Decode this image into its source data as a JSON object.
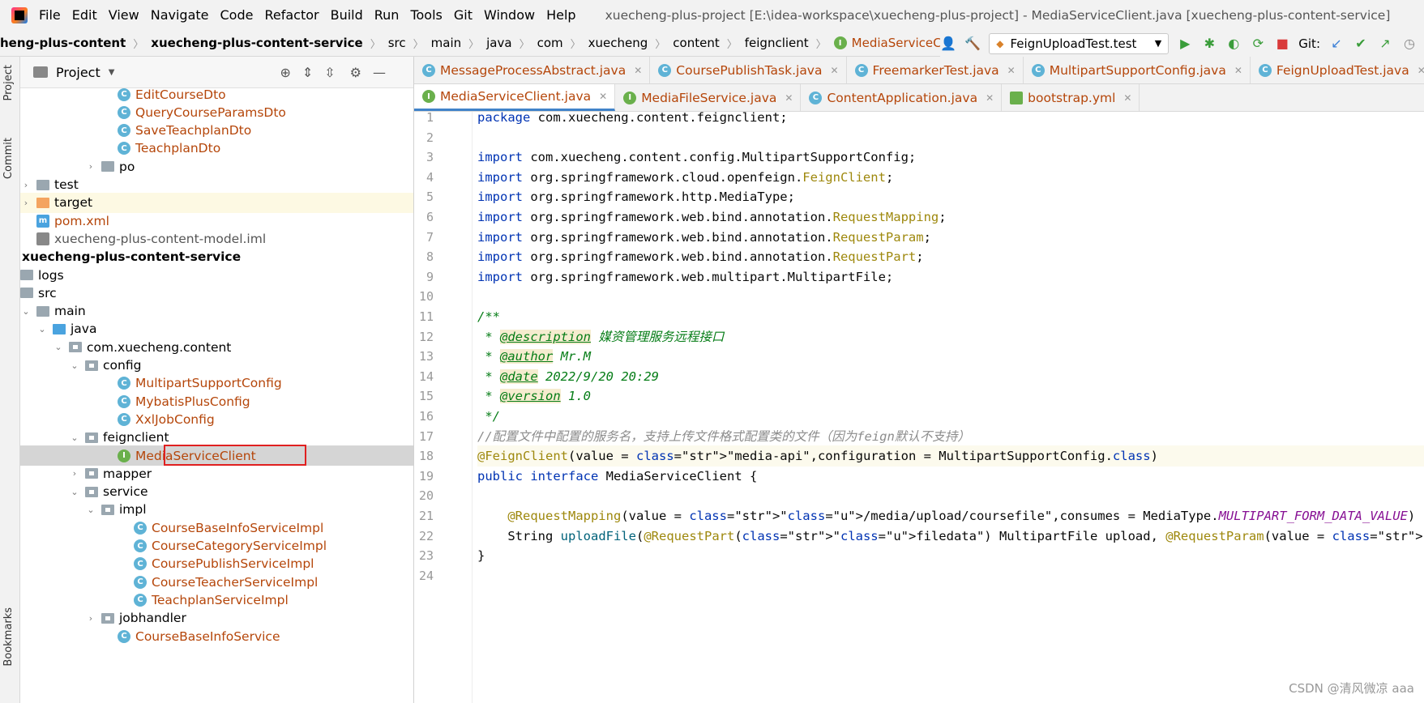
{
  "window": {
    "title": "xuecheng-plus-project [E:\\idea-workspace\\xuecheng-plus-project] - MediaServiceClient.java [xuecheng-plus-content-service]",
    "menu": [
      "File",
      "Edit",
      "View",
      "Navigate",
      "Code",
      "Refactor",
      "Build",
      "Run",
      "Tools",
      "Git",
      "Window",
      "Help"
    ]
  },
  "breadcrumb": [
    "heng-plus-content",
    "xuecheng-plus-content-service",
    "src",
    "main",
    "java",
    "com",
    "xuecheng",
    "content",
    "feignclient",
    "MediaServiceClient"
  ],
  "toolbar": {
    "run_config": "FeignUploadTest.test",
    "git_label": "Git:"
  },
  "sidebar": {
    "project_label": "Project",
    "commit_label": "Commit",
    "bookmarks_label": "Bookmarks"
  },
  "tree": [
    {
      "label": "EditCourseDto",
      "kind": "class",
      "color": "orange"
    },
    {
      "label": "QueryCourseParamsDto",
      "kind": "class",
      "color": "orange"
    },
    {
      "label": "SaveTeachplanDto",
      "kind": "class",
      "color": "orange"
    },
    {
      "label": "TeachplanDto",
      "kind": "class",
      "color": "orange"
    },
    {
      "label": "po",
      "kind": "folder"
    },
    {
      "label": "test",
      "kind": "folder"
    },
    {
      "label": "target",
      "kind": "folder"
    },
    {
      "label": "pom.xml",
      "kind": "file",
      "color": "orange"
    },
    {
      "label": "xuecheng-plus-content-model.iml",
      "kind": "file",
      "color": "gray"
    },
    {
      "label": "xuecheng-plus-content-service",
      "kind": "module"
    },
    {
      "label": "logs",
      "kind": "folder"
    },
    {
      "label": "src",
      "kind": "folder"
    },
    {
      "label": "main",
      "kind": "folder"
    },
    {
      "label": "java",
      "kind": "folder"
    },
    {
      "label": "com.xuecheng.content",
      "kind": "package"
    },
    {
      "label": "config",
      "kind": "package"
    },
    {
      "label": "MultipartSupportConfig",
      "kind": "class",
      "color": "orange"
    },
    {
      "label": "MybatisPlusConfig",
      "kind": "class",
      "color": "orange"
    },
    {
      "label": "XxlJobConfig",
      "kind": "class",
      "color": "orange"
    },
    {
      "label": "feignclient",
      "kind": "package"
    },
    {
      "label": "MediaServiceClient",
      "kind": "interface",
      "color": "orange"
    },
    {
      "label": "mapper",
      "kind": "package"
    },
    {
      "label": "service",
      "kind": "package"
    },
    {
      "label": "impl",
      "kind": "package"
    },
    {
      "label": "CourseBaseInfoServiceImpl",
      "kind": "class",
      "color": "orange"
    },
    {
      "label": "CourseCategoryServiceImpl",
      "kind": "class",
      "color": "orange"
    },
    {
      "label": "CoursePublishServiceImpl",
      "kind": "class",
      "color": "orange"
    },
    {
      "label": "CourseTeacherServiceImpl",
      "kind": "class",
      "color": "orange"
    },
    {
      "label": "TeachplanServiceImpl",
      "kind": "class",
      "color": "orange"
    },
    {
      "label": "jobhandler",
      "kind": "package"
    },
    {
      "label": "CourseBaseInfoService",
      "kind": "class",
      "color": "orange"
    }
  ],
  "tabs_row1": [
    "MessageProcessAbstract.java",
    "CoursePublishTask.java",
    "FreemarkerTest.java",
    "MultipartSupportConfig.java",
    "FeignUploadTest.java"
  ],
  "tabs_row2": [
    "MediaServiceClient.java",
    "MediaFileService.java",
    "ContentApplication.java",
    "bootstrap.yml"
  ],
  "code_lines": [
    "package com.xuecheng.content.feignclient;",
    "",
    "import com.xuecheng.content.config.MultipartSupportConfig;",
    "import org.springframework.cloud.openfeign.FeignClient;",
    "import org.springframework.http.MediaType;",
    "import org.springframework.web.bind.annotation.RequestMapping;",
    "import org.springframework.web.bind.annotation.RequestParam;",
    "import org.springframework.web.bind.annotation.RequestPart;",
    "import org.springframework.web.multipart.MultipartFile;",
    "",
    "/**",
    " * @description 媒资管理服务远程接口",
    " * @author Mr.M",
    " * @date 2022/9/20 20:29",
    " * @version 1.0",
    " */",
    "//配置文件中配置的服务名，支持上传文件格式配置类的文件（因为feign默认不支持）",
    "@FeignClient(value = \"media-api\",configuration = MultipartSupportConfig.class)",
    "public interface MediaServiceClient {",
    "",
    "    @RequestMapping(value = \"/media/upload/coursefile\",consumes = MediaType.MULTIPART_FORM_DATA_VALUE)",
    "    String uploadFile(@RequestPart(\"filedata\") MultipartFile upload, @RequestParam(value = \"objectName\",required=false",
    "}",
    ""
  ],
  "watermark": "CSDN @清风微凉 aaa"
}
